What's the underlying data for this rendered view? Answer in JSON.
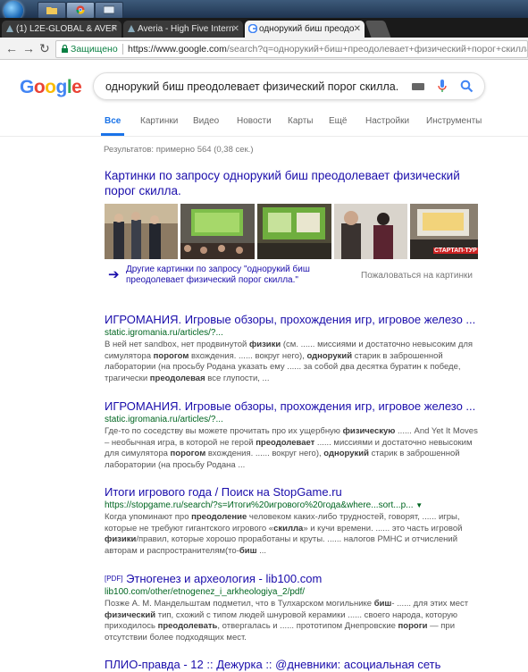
{
  "taskbar": {
    "buttons": [
      "start",
      "explorer",
      "chrome",
      "app"
    ]
  },
  "browser": {
    "tabs": [
      {
        "title": "(1) L2E-GLOBAL & AVEF",
        "active": false
      },
      {
        "title": "Averia - High Five Intern",
        "active": false
      },
      {
        "title": "однорукий биш преодо",
        "active": true
      }
    ],
    "secure_label": "Защищено",
    "url_host": "https://www.google.com",
    "url_rest": "/search?q=однорукий+биш+преодолевает+физический+порог+скилла.&oq="
  },
  "google": {
    "logo": "Google",
    "query": "однорукий биш преодолевает физический порог скилла.",
    "tabs": [
      "Все",
      "Картинки",
      "Видео",
      "Новости",
      "Карты",
      "Ещё",
      "Настройки",
      "Инструменты"
    ],
    "stats": "Результатов: примерно 564 (0,38 сек.)"
  },
  "images": {
    "title": "Картинки по запросу однорукий биш преодолевает физический порог скилла.",
    "more": "Другие картинки по запросу \"однорукий биш преодолевает физический порог скилла.\"",
    "complain": "Пожаловаться на картинки",
    "thumb_caption": "СТАРТАП-ТУР"
  },
  "results": [
    {
      "title": "ИГРОМАНИЯ. Игровые обзоры, прохождения игр, игровое железо ...",
      "url": "static.igromania.ru/articles/?...",
      "snippet": "В ней нет sandbox, нет продвинутой физики (см. ...... миссиями и достаточно невысоким для симулятора порогом вхождения. ...... вокруг него), однорукий старик в заброшенной лаборатории (на просьбу Родана указать ему ...... за собой два десятка буратин к победе, трагически преодолевая все глупости, ..."
    },
    {
      "title": "ИГРОМАНИЯ. Игровые обзоры, прохождения игр, игровое железо ...",
      "url": "static.igromania.ru/articles/?...",
      "snippet": "Где-то по соседству вы можете прочитать про их ущербную физическую ...... And Yet It Moves – необычная игра, в которой не герой преодолевает ...... миссиями и достаточно невысоким для симулятора порогом вхождения. ...... вокруг него), однорукий старик в заброшенной лаборатории (на просьбу Родана ..."
    },
    {
      "title": "Итоги игрового года / Поиск на StopGame.ru",
      "url": "https://stopgame.ru/search/?s=Итоги%20игрового%20года&where...sort...p...",
      "snippet": "Когда упоминают про преодоление человеком каких-либо трудностей, говорят, ...... игры, которые не требуют гигантского игрового «скилла» и кучи времени. ...... это часть игровой физики/правил, которые хорошо проработаны и круты. ...... налогов РМНС и отчислений авторам и распространителям(то-биш ..."
    },
    {
      "pdf": "[PDF]",
      "title": "Этногенез и археология - lib100.com",
      "url": "lib100.com/other/etnogenez_i_arkheologiya_2/pdf/",
      "snippet": "Позже А. М. Мандельштам подметил, что в Тулхарском могильнике биш- ...... для этих мест физический тип, схожий с типом людей шнуровой керамики ...... своего народа, которую приходилось преодолевать, отвергалась и ...... прототипом Днепровские пороги — при отсутствии более подходящих мест."
    },
    {
      "title": "ПЛИО-правда - 12 :: Дежурка :: @дневники: асоциальная сеть"
    }
  ]
}
